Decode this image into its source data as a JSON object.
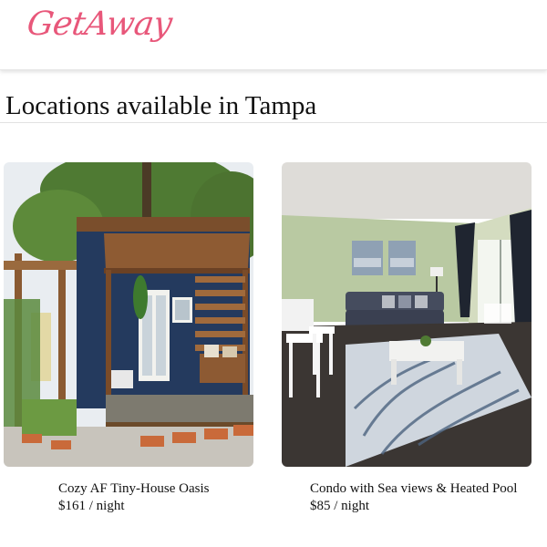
{
  "header": {
    "logo_text": "GetAway",
    "logo_color": "#e8577a"
  },
  "main": {
    "title": "Locations available in Tampa",
    "listings": [
      {
        "name": "Cozy AF Tiny-House Oasis",
        "price": "$161 / night",
        "photo_subject": "tiny-house-backyard-photo"
      },
      {
        "name": "Condo with Sea views & Heated Pool",
        "price": "$85 / night",
        "photo_subject": "condo-living-room-photo"
      }
    ]
  }
}
